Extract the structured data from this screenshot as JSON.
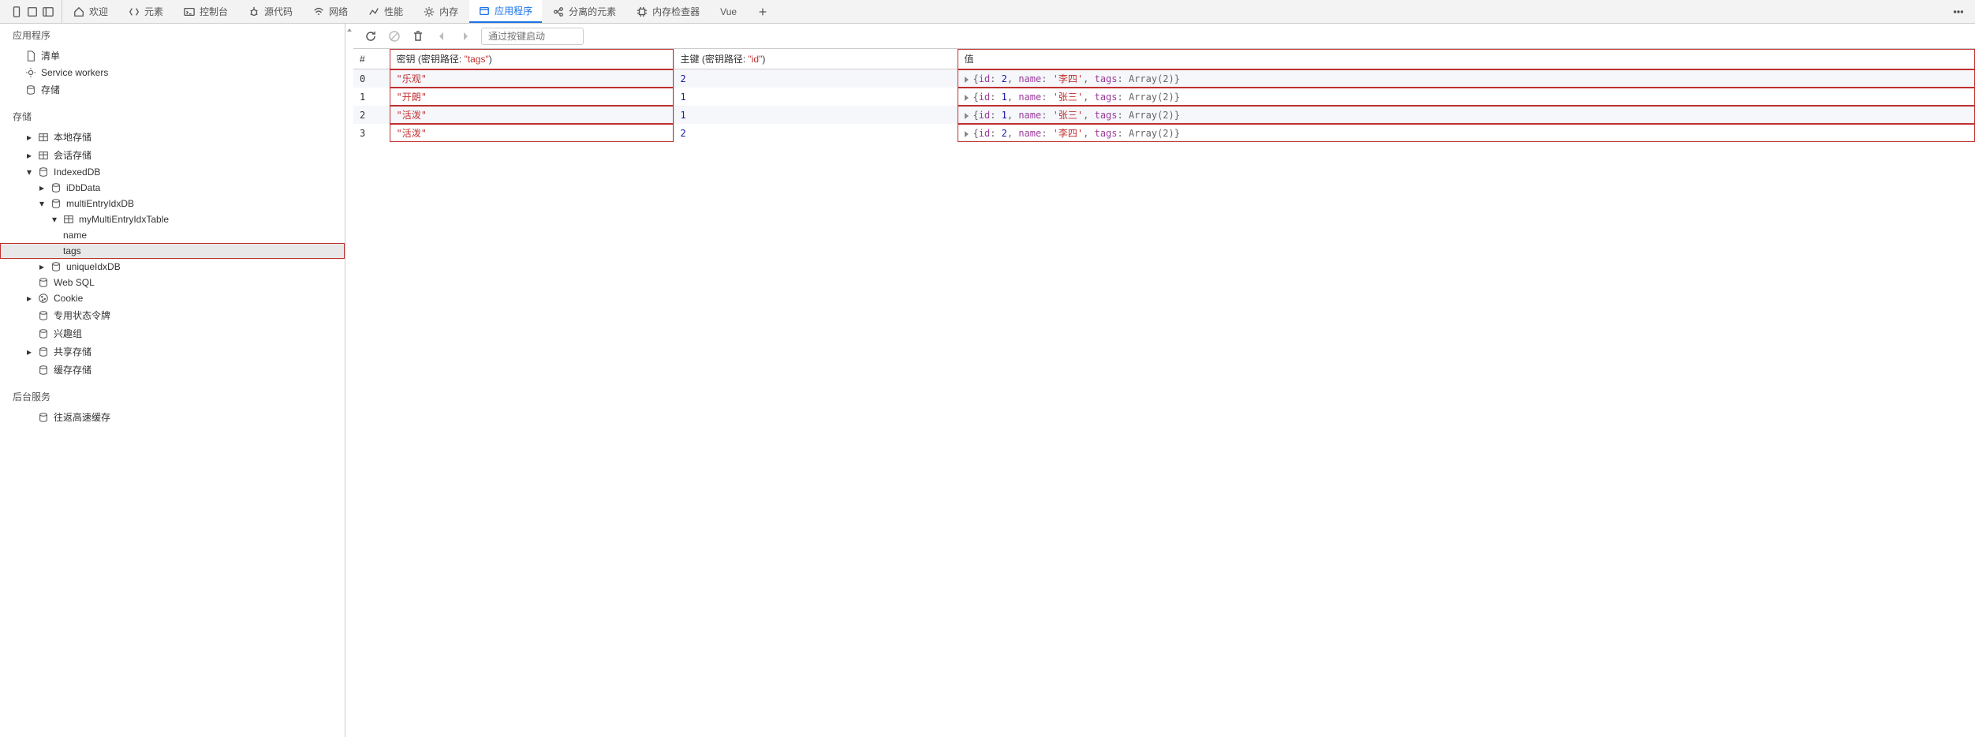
{
  "tabs": {
    "welcome": "欢迎",
    "elements": "元素",
    "console": "控制台",
    "sources": "源代码",
    "network": "网络",
    "performance": "性能",
    "memory": "内存",
    "application": "应用程序",
    "detached": "分离的元素",
    "meminspect": "内存检查器",
    "vue": "Vue"
  },
  "sidebar": {
    "sectionApp": "应用程序",
    "manifest": "清单",
    "sw": "Service workers",
    "storage": "存储",
    "sectionStorage": "存储",
    "localStorage": "本地存储",
    "sessionStorage": "会话存储",
    "indexeddb": "IndexedDB",
    "idbData": "iDbData",
    "multiEntryDB": "multiEntryIdxDB",
    "multiEntryTable": "myMultiEntryIdxTable",
    "idxName": "name",
    "idxTags": "tags",
    "uniqueIdxDB": "uniqueIdxDB",
    "websql": "Web SQL",
    "cookie": "Cookie",
    "privateState": "专用状态令牌",
    "interestGroups": "兴趣组",
    "sharedStorage": "共享存储",
    "cacheStorage": "缓存存储",
    "sectionBg": "后台服务",
    "bfcache": "往返高速缓存"
  },
  "toolbar": {
    "placeholder": "通过按键启动"
  },
  "table": {
    "colIndex": "#",
    "colKeyLabel": "密钥 (密钥路径: ",
    "colKeyPath": "\"tags\"",
    "colPKLabel": "主键 (密钥路径: ",
    "colPKPath": "\"id\"",
    "colValue": "值",
    "rows": [
      {
        "i": "0",
        "key": "\"乐观\"",
        "pk": "2",
        "val": "{id: 2, name: '李四', tags: Array(2)}"
      },
      {
        "i": "1",
        "key": "\"开朗\"",
        "pk": "1",
        "val": "{id: 1, name: '张三', tags: Array(2)}"
      },
      {
        "i": "2",
        "key": "\"活泼\"",
        "pk": "1",
        "val": "{id: 1, name: '张三', tags: Array(2)}"
      },
      {
        "i": "3",
        "key": "\"活泼\"",
        "pk": "2",
        "val": "{id: 2, name: '李四', tags: Array(2)}"
      }
    ]
  }
}
